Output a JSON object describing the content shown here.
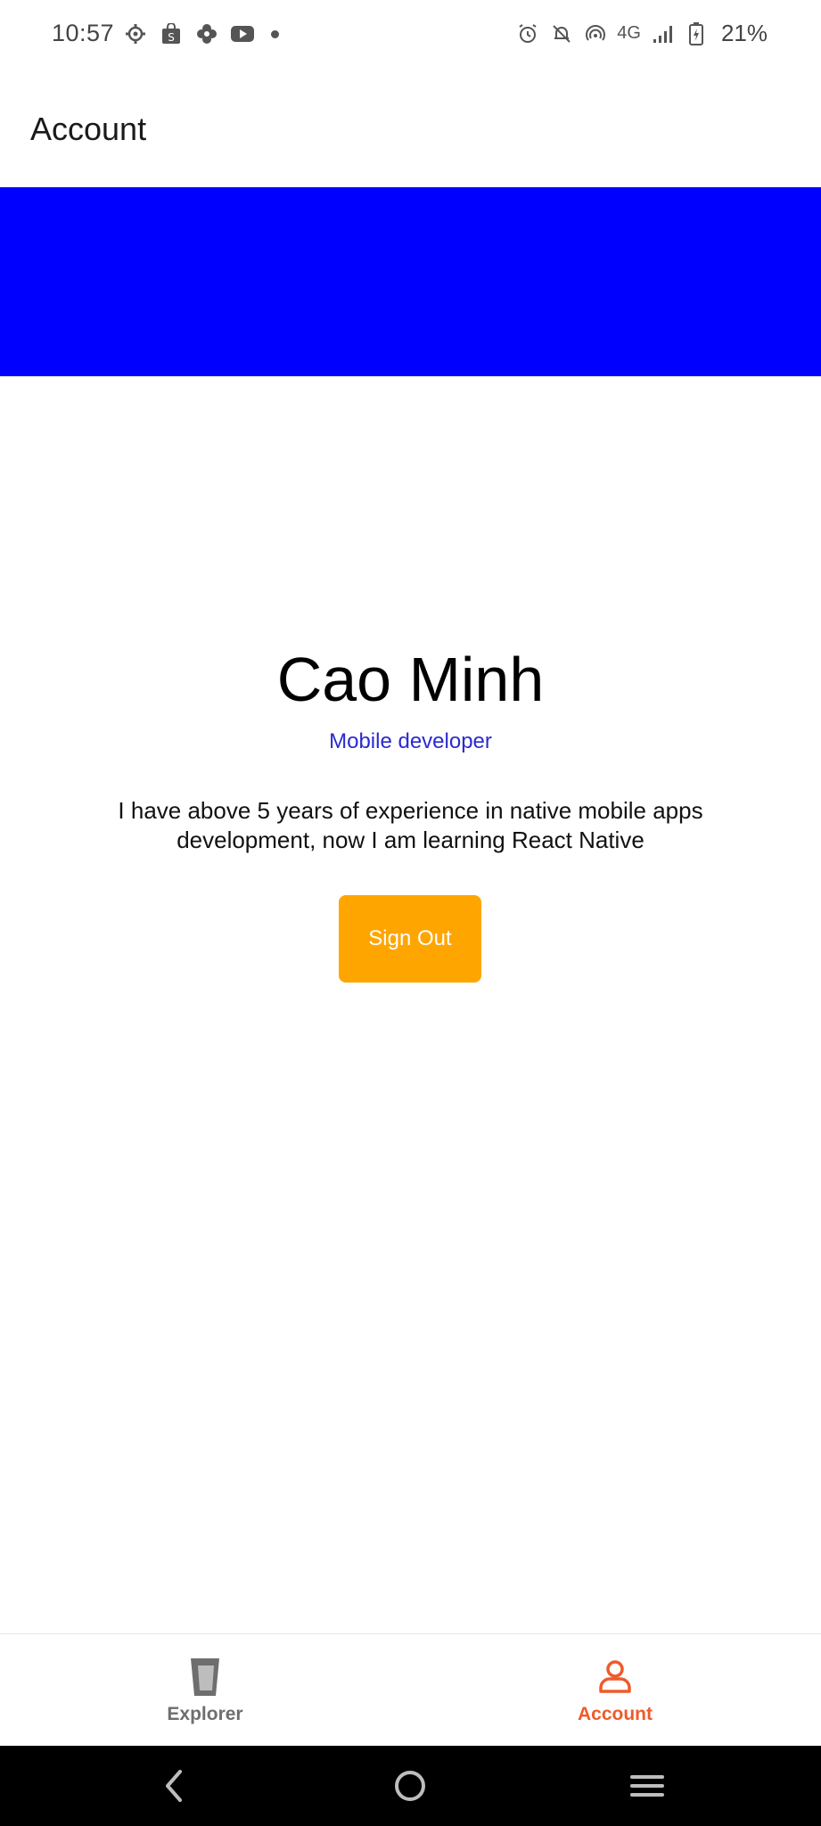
{
  "status_bar": {
    "time": "10:57",
    "network": "4G",
    "battery": "21%",
    "left_icons": [
      "settings-icon",
      "shopee-icon",
      "photos-icon",
      "youtube-icon",
      "notification-dot-icon"
    ],
    "right_icons": [
      "alarm-icon",
      "mute-icon",
      "hotspot-icon",
      "signal-icon",
      "battery-icon"
    ]
  },
  "header": {
    "title": "Account"
  },
  "banner": {
    "color": "#0000ff"
  },
  "profile": {
    "name": "Cao Minh",
    "role": "Mobile developer",
    "bio": "I have above 5 years of experience in native mobile apps development, now I am learning React Native"
  },
  "actions": {
    "sign_out_label": "Sign Out",
    "sign_out_color": "#ffa500"
  },
  "tabs": [
    {
      "label": "Explorer",
      "icon": "glass-icon",
      "active": false,
      "color": "#6e6e6e"
    },
    {
      "label": "Account",
      "icon": "user-icon",
      "active": true,
      "color": "#f05a2a"
    }
  ],
  "nav_bar": {
    "buttons": [
      "back-icon",
      "home-icon",
      "recents-icon"
    ]
  }
}
